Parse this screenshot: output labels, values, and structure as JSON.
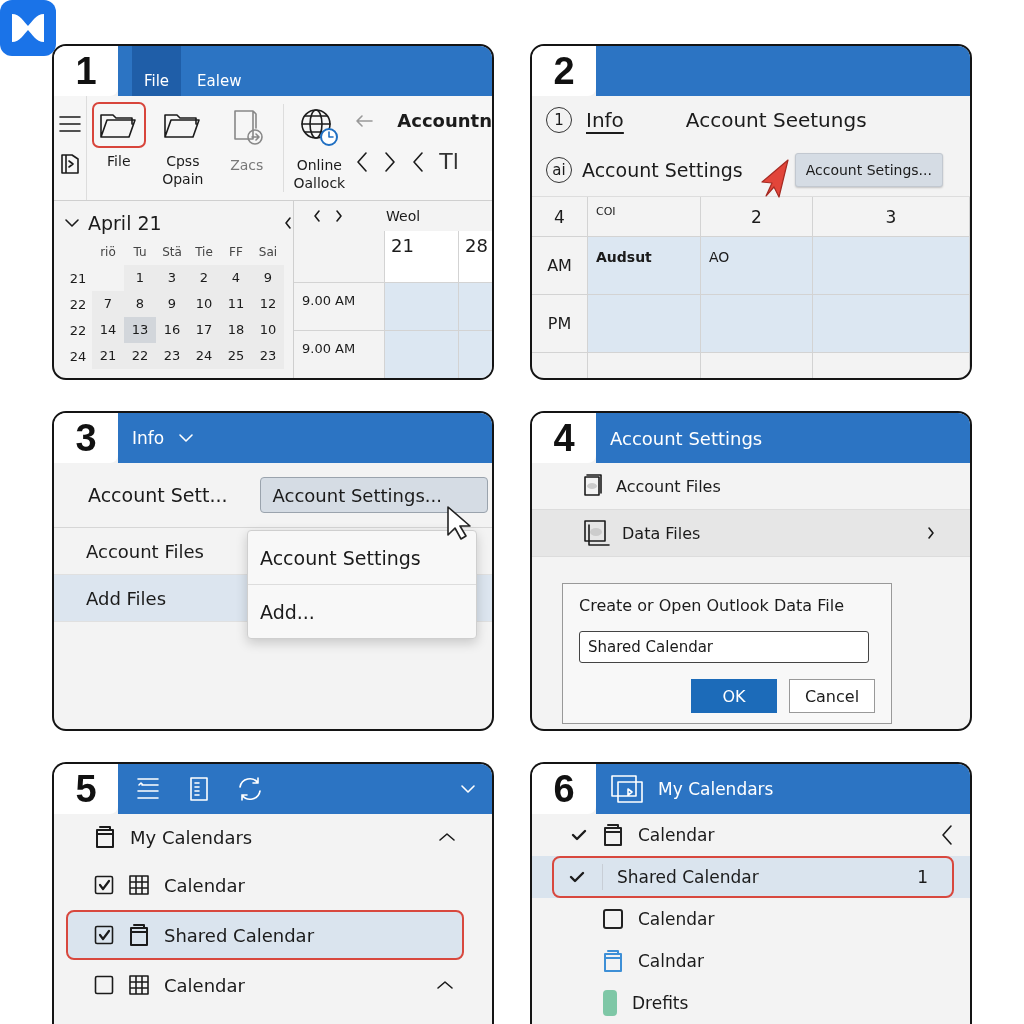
{
  "panels": [
    {
      "number": "1",
      "kind": "ribbon",
      "tabs": [
        {
          "label": "File",
          "selected": true
        },
        {
          "label": "Ealew",
          "selected": false
        }
      ],
      "ribbon_buttons": [
        {
          "kind": "folder",
          "label": "File",
          "highlighted": true,
          "disabled": false
        },
        {
          "kind": "folder",
          "label": "Cpss\nOpain",
          "highlighted": false,
          "disabled": false
        },
        {
          "kind": "document",
          "label": "Zacs",
          "highlighted": false,
          "disabled": true
        },
        {
          "kind": "globe",
          "label": "Online\nOallock",
          "highlighted": false,
          "disabled": false
        }
      ],
      "title": "Accountn",
      "toolbar_text": "Tl",
      "mini_calendar": {
        "title": "April 21",
        "expanded": true,
        "weekdays": [
          "riö",
          "Tu",
          "Stä",
          "Tie",
          "FF",
          "Sai"
        ],
        "weeks": [
          {
            "number": "21",
            "days": [
              {
                "label": "1",
                "selected": false
              },
              {
                "label": "3",
                "selected": false
              },
              {
                "label": "2",
                "selected": false
              },
              {
                "label": "4",
                "selected": false
              },
              {
                "label": "9",
                "selected": false
              }
            ]
          },
          {
            "number": "22",
            "days": [
              {
                "label": "7",
                "selected": false
              },
              {
                "label": "8",
                "selected": false
              },
              {
                "label": "9",
                "selected": false
              },
              {
                "label": "10",
                "selected": false
              },
              {
                "label": "11",
                "selected": false
              },
              {
                "label": "12",
                "selected": false
              }
            ]
          },
          {
            "number": "22",
            "days": [
              {
                "label": "14",
                "selected": false
              },
              {
                "label": "13",
                "selected": true
              },
              {
                "label": "16",
                "selected": false
              },
              {
                "label": "17",
                "selected": false
              },
              {
                "label": "18",
                "selected": false
              },
              {
                "label": "10",
                "selected": false
              }
            ]
          },
          {
            "number": "24",
            "days": [
              {
                "label": "21",
                "selected": false
              },
              {
                "label": "22",
                "selected": false
              },
              {
                "label": "23",
                "selected": false
              },
              {
                "label": "24",
                "selected": false
              },
              {
                "label": "25",
                "selected": false
              },
              {
                "label": "23",
                "selected": false
              }
            ]
          }
        ]
      },
      "week_view": {
        "title": "Weol",
        "days": [
          "21",
          "28"
        ],
        "times": [
          "9.00 AM",
          "9.00 AM"
        ]
      }
    },
    {
      "number": "2",
      "kind": "info",
      "tabs": [
        {
          "label": "Info",
          "selected": true
        },
        {
          "label": "Account Seetungs",
          "selected": false
        }
      ],
      "step_badge": "1",
      "setting_badge": "ai",
      "setting_label": "Account Settings",
      "button": "Account Setings...",
      "grid": {
        "corner": "4",
        "columns": [
          "COI",
          "2",
          "3"
        ],
        "rows": [
          {
            "label": "AM",
            "cells": [
              "Audsut",
              "AO"
            ]
          },
          {
            "label": "PM"
          }
        ]
      }
    },
    {
      "number": "3",
      "kind": "menu",
      "header": "Info",
      "label": "Account Sett...",
      "button": "Account Settings...",
      "rows": [
        {
          "label": "Account Files",
          "selected": false
        },
        {
          "label": "Add Files",
          "selected": true
        }
      ],
      "menu": [
        "Account Settings",
        "Add..."
      ]
    },
    {
      "number": "4",
      "kind": "dialog",
      "header": "Account Settings",
      "rows": [
        {
          "label": "Account Files",
          "selected": false,
          "submenu": false
        },
        {
          "label": "Data Files",
          "selected": true,
          "submenu": true
        }
      ],
      "dialog": {
        "title": "Create or Open Outlook Data File",
        "value": "Shared Calendar",
        "buttons": [
          {
            "label": "OK",
            "primary": true
          },
          {
            "label": "Cancel",
            "primary": false
          }
        ]
      }
    },
    {
      "number": "5",
      "kind": "tree",
      "items": [
        {
          "label": "My Calendars",
          "expanded": true,
          "children": [
            {
              "kind": "grid",
              "label": "Calendar",
              "checked": true,
              "selected": false
            },
            {
              "kind": "calendar",
              "label": "Shared Calendar",
              "checked": true,
              "selected": true
            },
            {
              "kind": "grid",
              "label": "Calendar",
              "checked": false,
              "selected": false,
              "expanded": true
            }
          ]
        }
      ]
    },
    {
      "number": "6",
      "kind": "list",
      "header": "My Calendars",
      "items": [
        {
          "kind": "calendar",
          "label": "Calendar",
          "checked": true,
          "selected": false,
          "expanded": false,
          "color": "#222222"
        },
        {
          "kind": "none",
          "label": "Shared Calendar",
          "checked": true,
          "selected": true,
          "count": "1"
        },
        {
          "kind": "square",
          "label": "Calendar",
          "checked": false,
          "selected": false,
          "color": "#222222"
        },
        {
          "kind": "calendar",
          "label": "Calndar",
          "checked": false,
          "selected": false,
          "color": "#3d8fd6"
        },
        {
          "kind": "tag",
          "label": "Drefits",
          "checked": false,
          "selected": false,
          "color": "#7ec7a6"
        }
      ]
    }
  ]
}
